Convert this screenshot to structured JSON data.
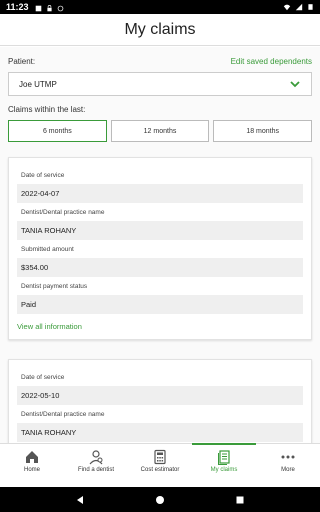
{
  "status_bar": {
    "time": "11:23"
  },
  "header": {
    "title": "My claims"
  },
  "patient": {
    "label": "Patient:",
    "edit_link": "Edit saved dependents",
    "selected": "Joe UTMP"
  },
  "claims_filter": {
    "label": "Claims within the last:",
    "options": [
      "6 months",
      "12 months",
      "18 months"
    ],
    "selected": "6 months"
  },
  "claims": [
    {
      "date_label": "Date of service",
      "date": "2022-04-07",
      "dentist_label": "Dentist/Dental practice name",
      "dentist": "TANIA ROHANY",
      "amount_label": "Submitted amount",
      "amount": "$354.00",
      "status_label": "Dentist payment status",
      "status": "Paid",
      "view_link": "View all information"
    },
    {
      "date_label": "Date of service",
      "date": "2022-05-10",
      "dentist_label": "Dentist/Dental practice name",
      "dentist": "TANIA ROHANY"
    }
  ],
  "bottom_nav": {
    "items": [
      {
        "label": "Home",
        "icon": "home-icon"
      },
      {
        "label": "Find a dentist",
        "icon": "find-dentist-icon"
      },
      {
        "label": "Cost estimator",
        "icon": "calculator-icon"
      },
      {
        "label": "My claims",
        "icon": "claims-icon"
      },
      {
        "label": "More",
        "icon": "more-icon"
      }
    ],
    "active": "My claims"
  },
  "colors": {
    "accent": "#3a9b3a"
  }
}
